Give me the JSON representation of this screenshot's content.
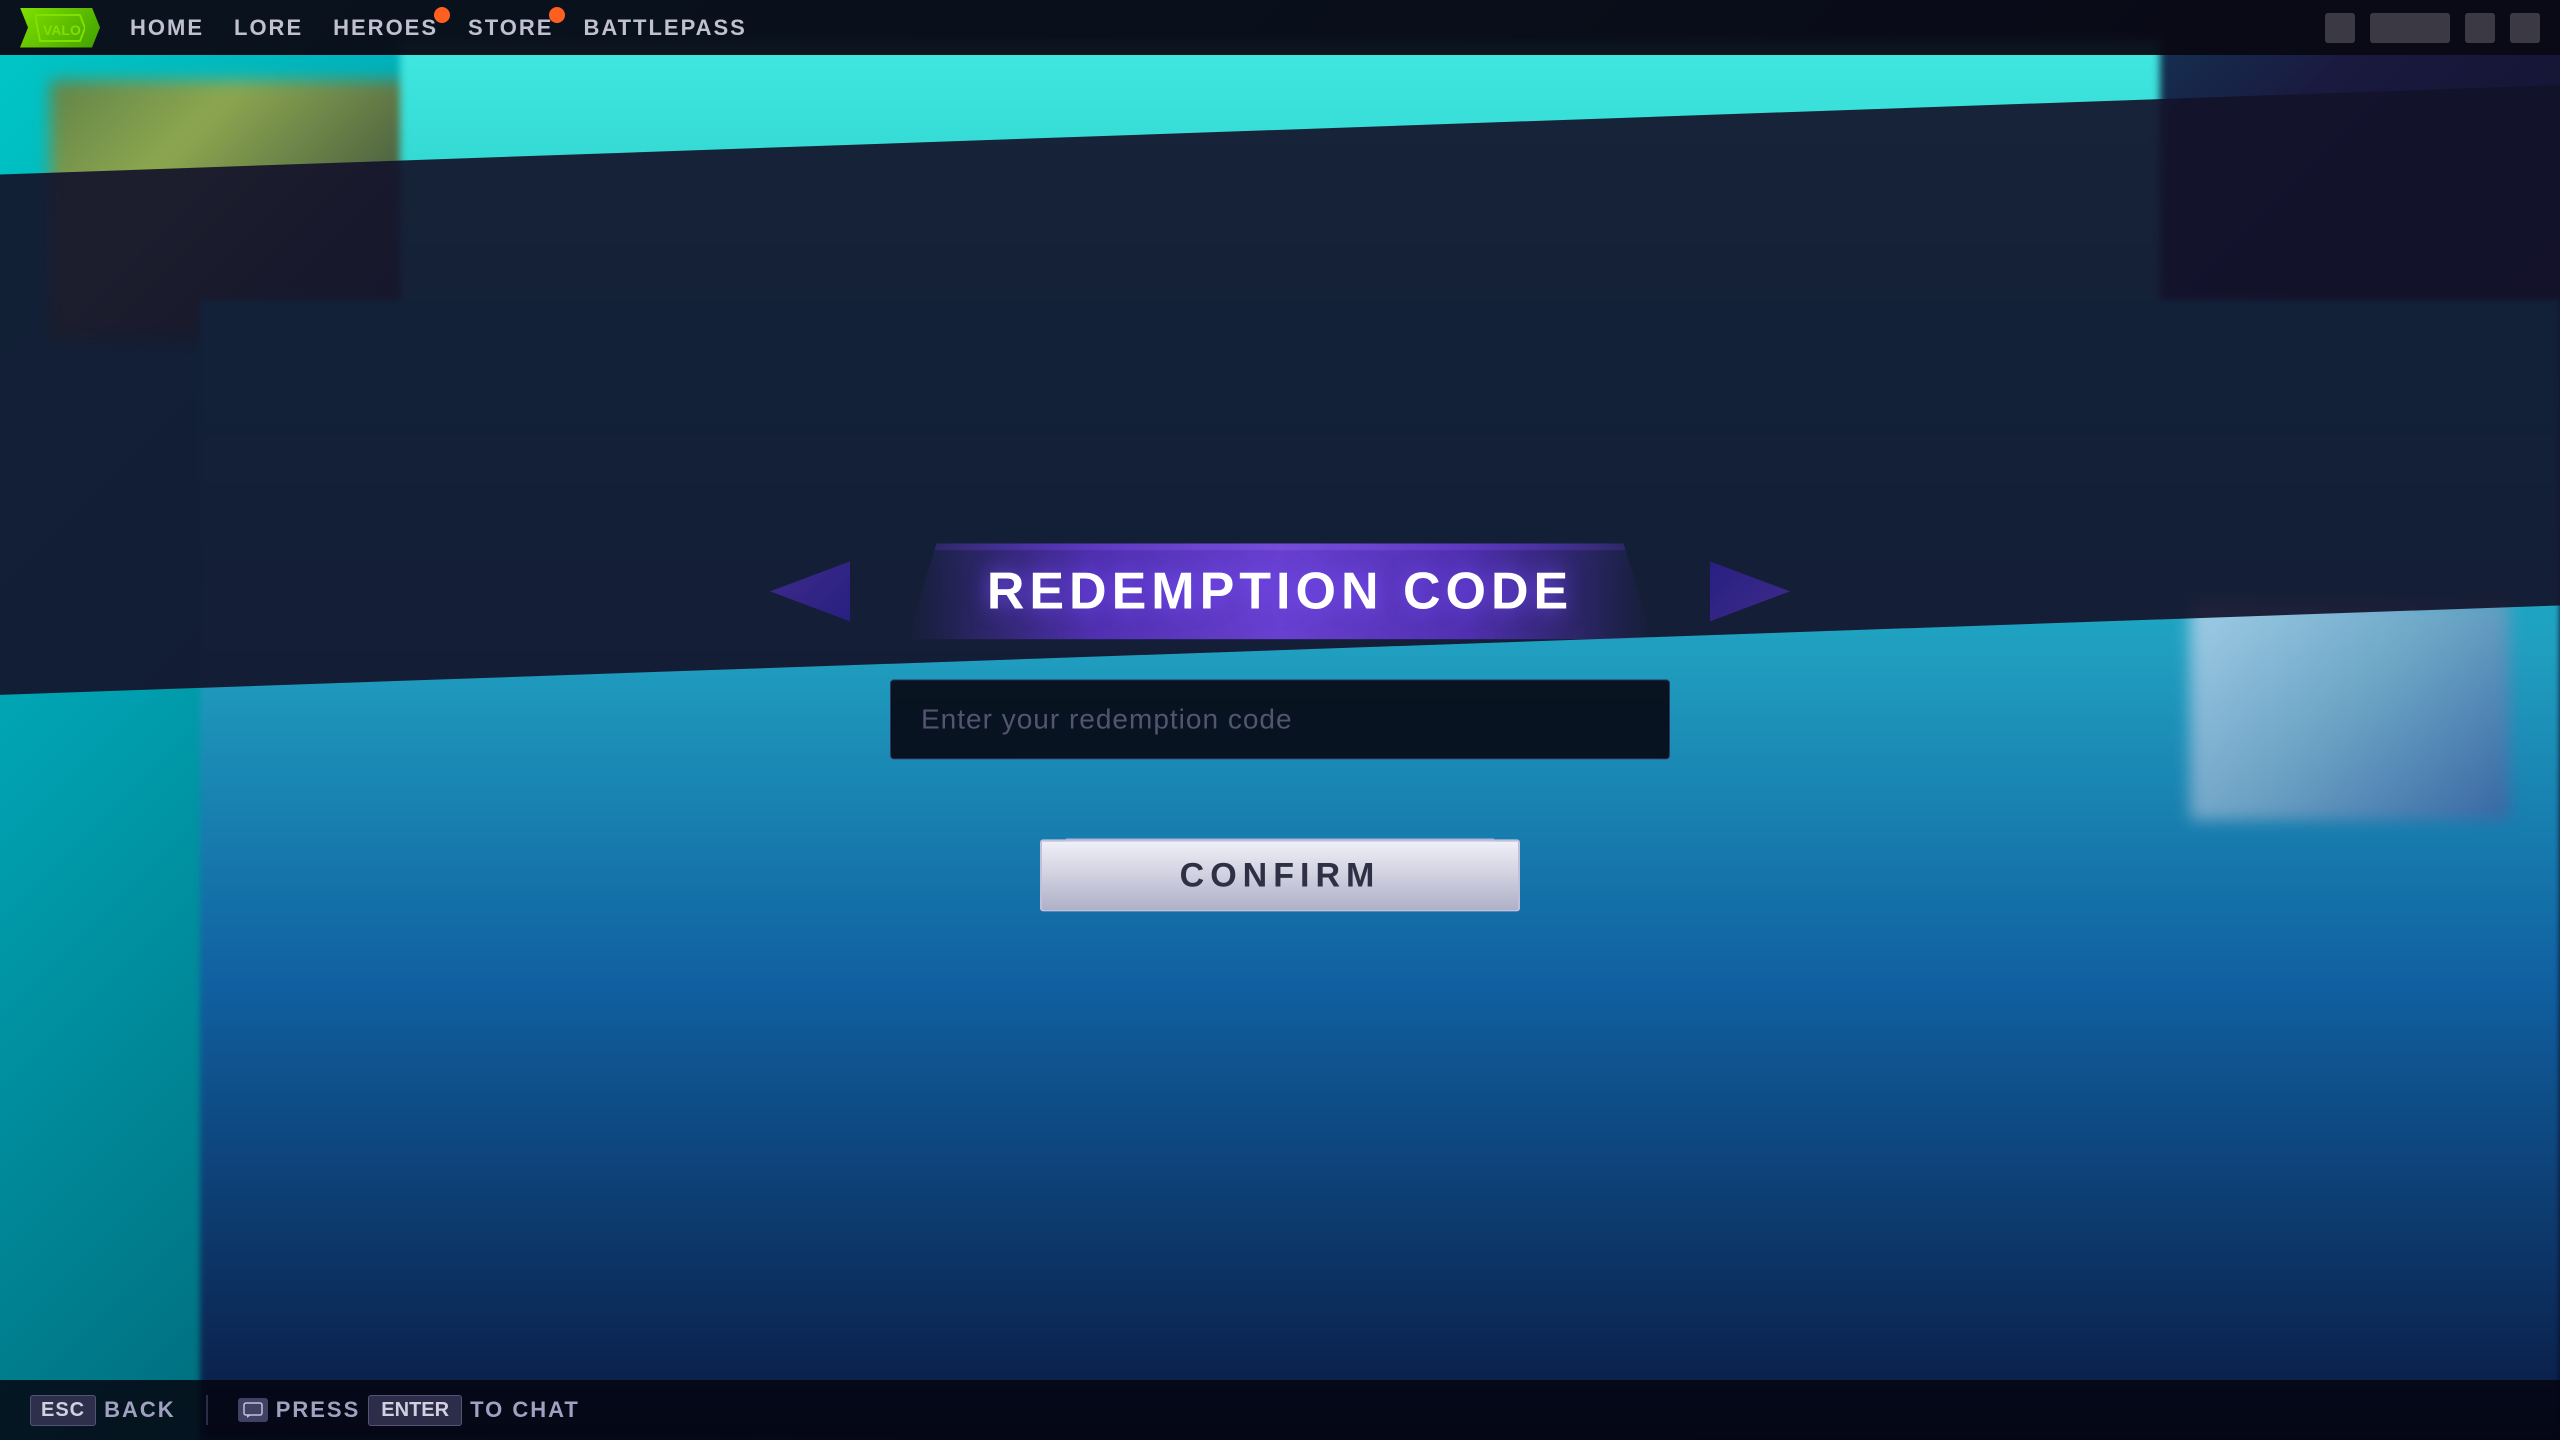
{
  "nav": {
    "items": [
      {
        "label": "HOME",
        "badge": false
      },
      {
        "label": "LORE",
        "badge": false
      },
      {
        "label": "HEROES",
        "badge": true
      },
      {
        "label": "STORE",
        "badge": true
      },
      {
        "label": "BATTLEPASS",
        "badge": false
      }
    ]
  },
  "dialog": {
    "title": "REDEMPTION CODE",
    "input_placeholder": "Enter your redemption code",
    "confirm_button": "CONFIRM"
  },
  "hud": {
    "esc_key": "ESC",
    "esc_label": "BACK",
    "press_label": "Press",
    "enter_key": "ENTER",
    "chat_label": "to Chat"
  }
}
